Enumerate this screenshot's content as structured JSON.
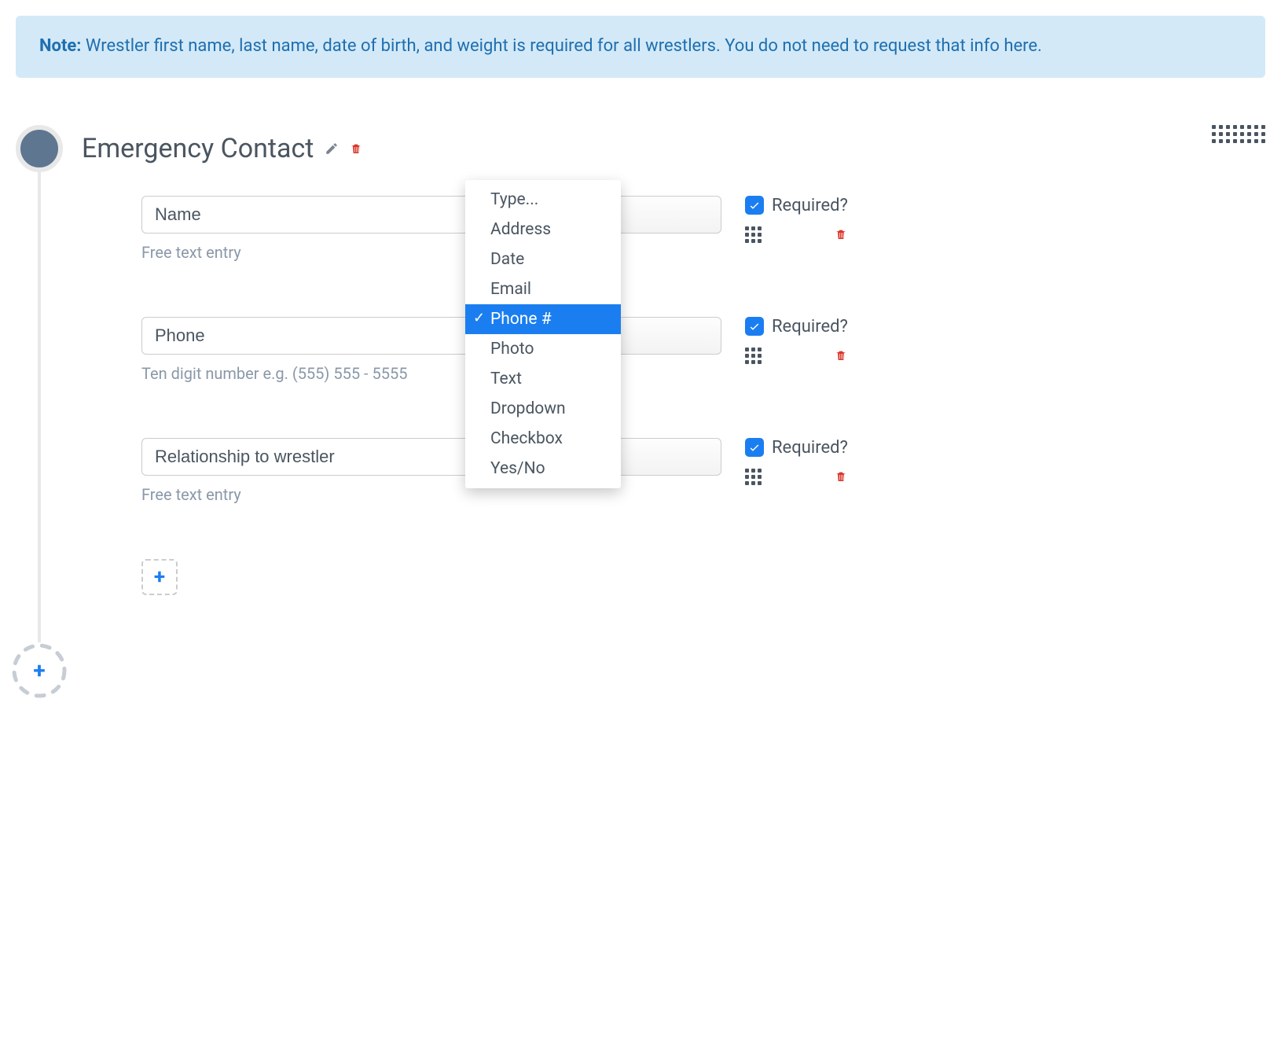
{
  "note": {
    "label": "Note:",
    "text": " Wrestler first name, last name, date of birth, and weight is required for all wrestlers. You do not need to request that info here."
  },
  "section": {
    "title": "Emergency Contact"
  },
  "fields": [
    {
      "label": "Name",
      "hint": "Free text entry",
      "required_label": "Required?"
    },
    {
      "label": "Phone",
      "hint": "Ten digit number e.g. (555) 555 - 5555",
      "required_label": "Required?"
    },
    {
      "label": "Relationship to wrestler",
      "hint": "Free text entry",
      "required_label": "Required?"
    }
  ],
  "type_dropdown": {
    "options": [
      "Type...",
      "Address",
      "Date",
      "Email",
      "Phone #",
      "Photo",
      "Text",
      "Dropdown",
      "Checkbox",
      "Yes/No"
    ],
    "selected": "Phone #"
  },
  "colors": {
    "note_bg": "#d3e9f7",
    "note_text": "#1e6fb0",
    "accent": "#1b7ef0",
    "danger": "#d9372b",
    "circle": "#5f7690"
  }
}
